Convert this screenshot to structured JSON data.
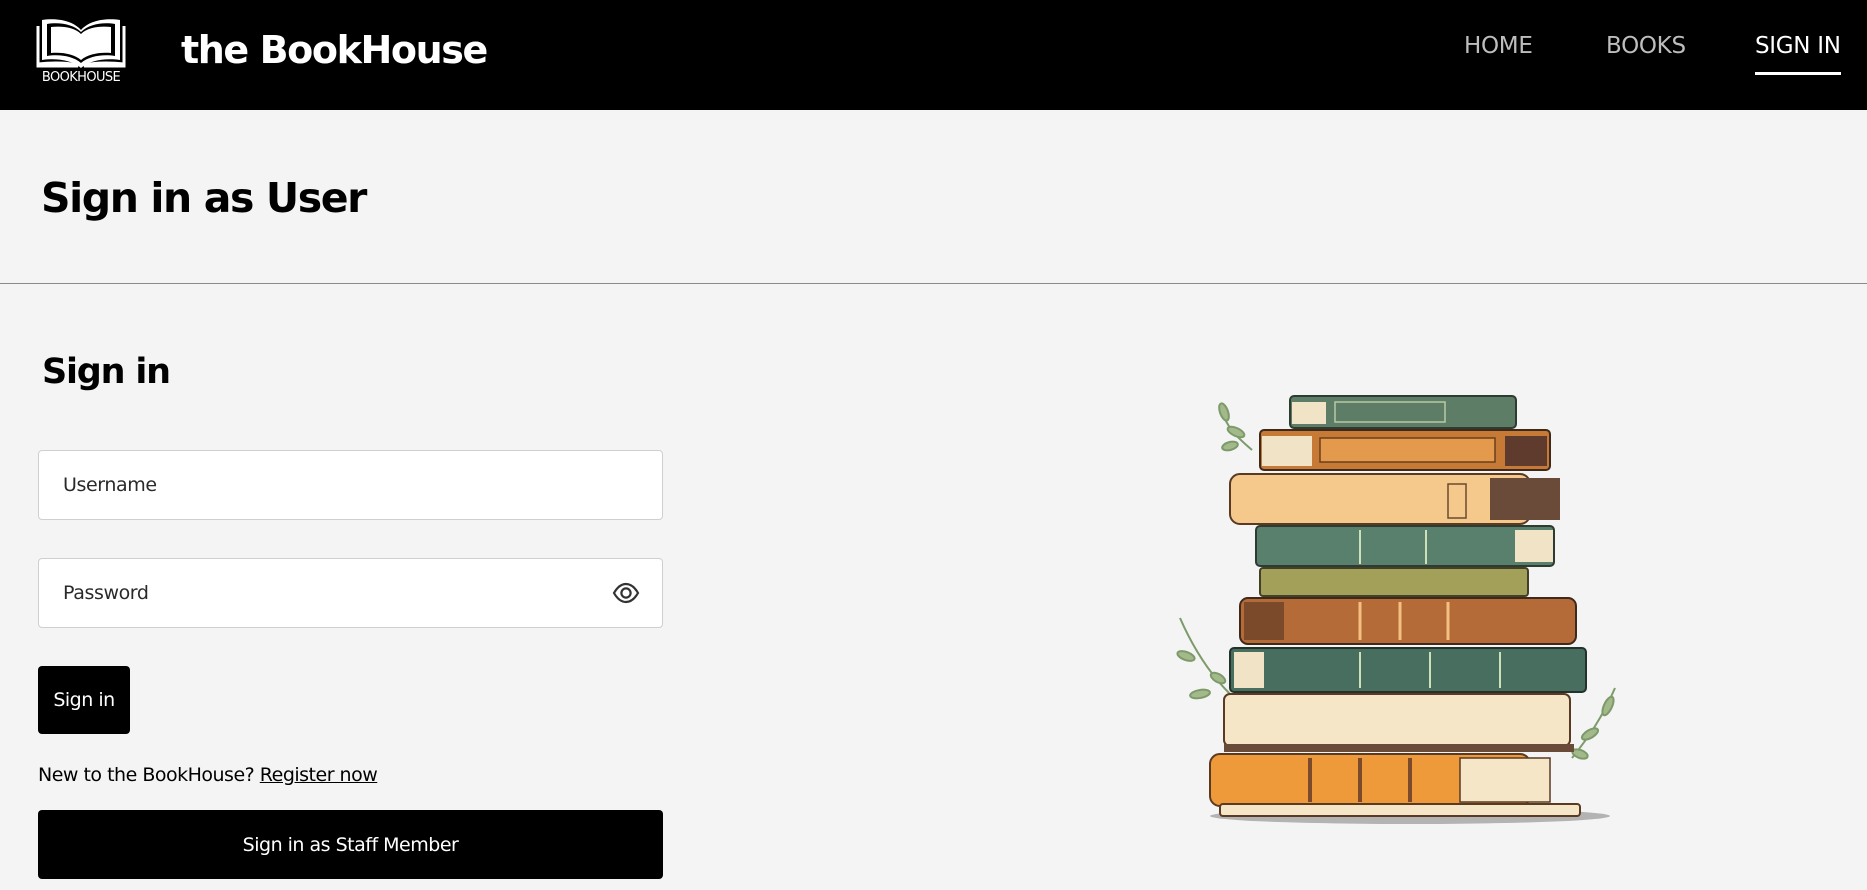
{
  "header": {
    "logo_text": "BOOKHOUSE",
    "site_title": "the BookHouse",
    "nav": [
      {
        "label": "HOME",
        "active": false
      },
      {
        "label": "BOOKS",
        "active": false
      },
      {
        "label": "SIGN IN",
        "active": true
      }
    ]
  },
  "page": {
    "title": "Sign in as User"
  },
  "form": {
    "heading": "Sign in",
    "username_placeholder": "Username",
    "password_placeholder": "Password",
    "show_password_icon": "eye-icon",
    "submit_label": "Sign in",
    "register_prompt": "New to the BookHouse?",
    "register_link": "Register now",
    "staff_button_label": "Sign in as Staff Member"
  },
  "colors": {
    "header_bg": "#000000",
    "page_bg": "#f4f4f4",
    "button_bg": "#000000",
    "nav_inactive": "#bdbdbd",
    "nav_active": "#ffffff"
  }
}
